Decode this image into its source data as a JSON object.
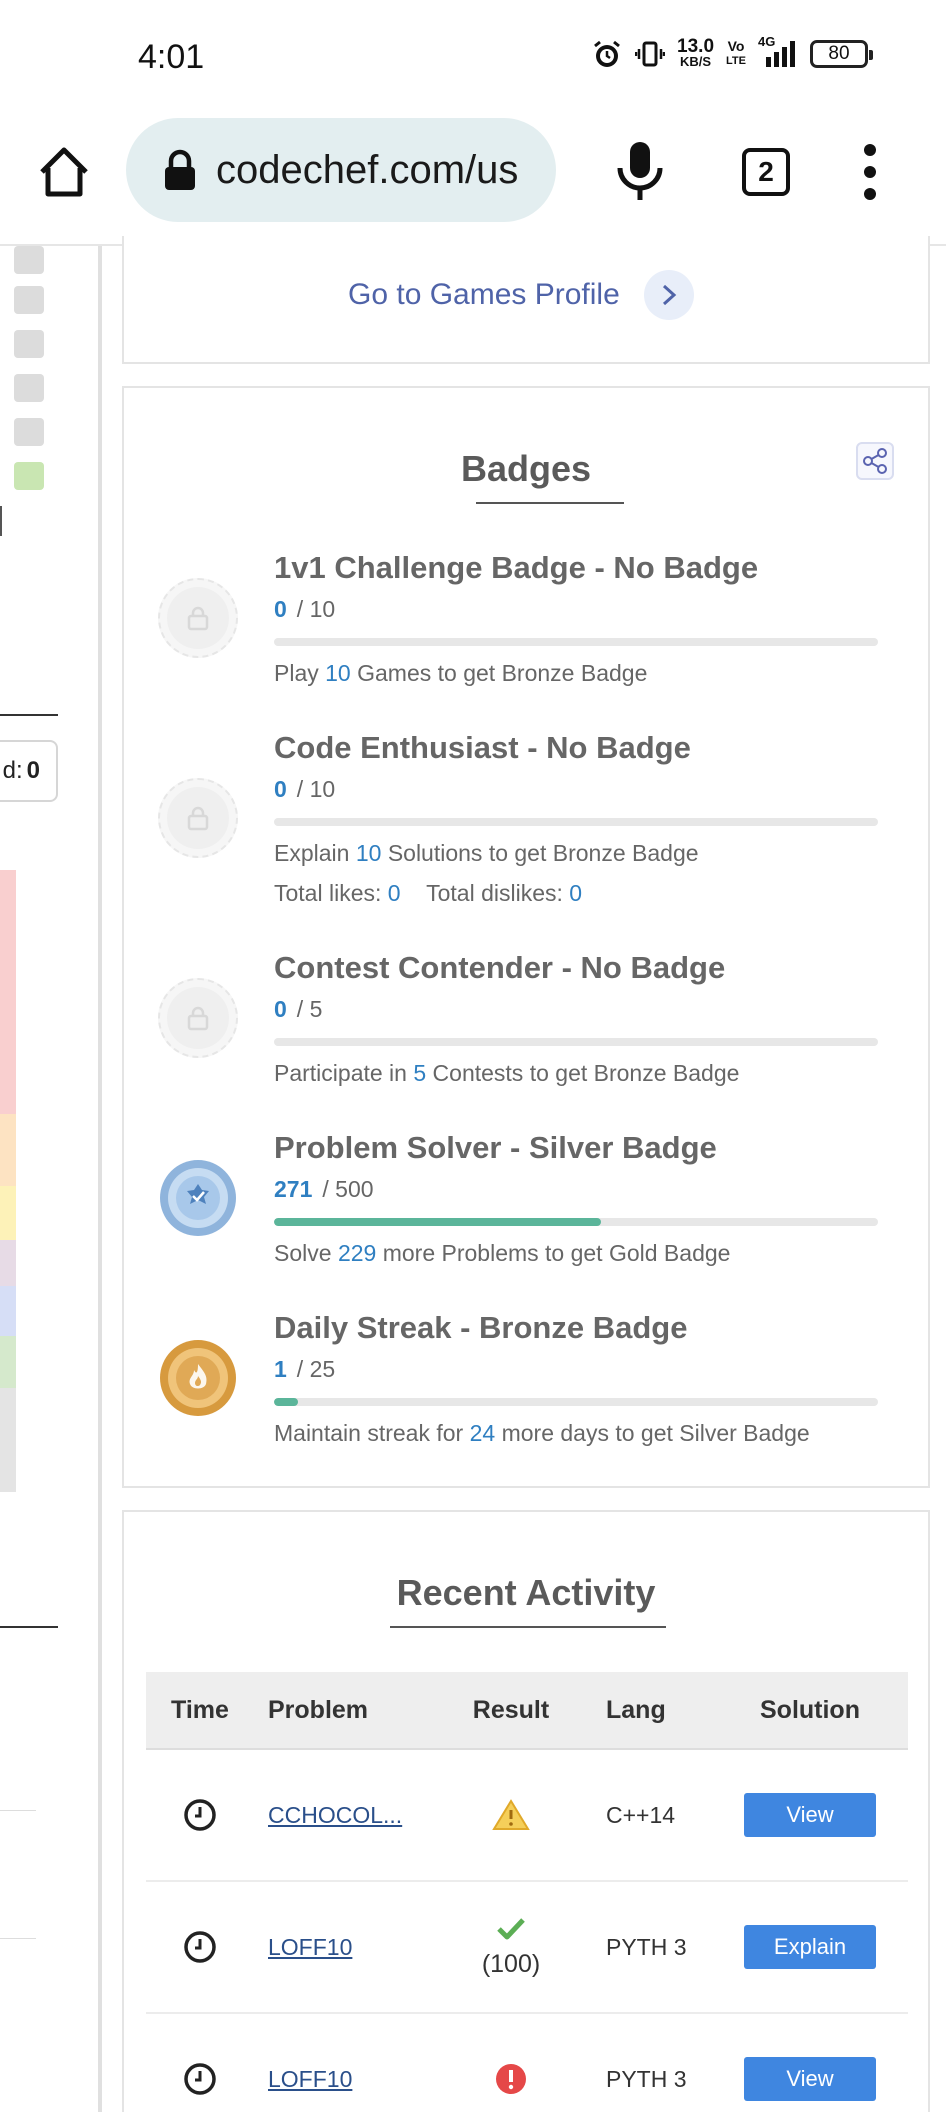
{
  "status_bar": {
    "time": "4:01",
    "net_speed_value": "13.0",
    "net_speed_unit": "KB/S",
    "volte_top": "Vo",
    "volte_bottom": "LTE",
    "network": "4G",
    "battery": "80",
    "icons": [
      "alarm-icon",
      "vibrate-icon",
      "signal-icon",
      "battery-icon"
    ]
  },
  "browser": {
    "url": "codechef.com/us",
    "tab_count": "2",
    "icons": [
      "home-icon",
      "lock-icon",
      "mic-icon",
      "tabs-icon",
      "more-vert-icon"
    ]
  },
  "left_panel": {
    "solved_label": "d:",
    "solved_value": "0"
  },
  "games": {
    "link_label": "Go to Games Profile"
  },
  "badges": {
    "title": "Badges",
    "items": [
      {
        "name": "1v1 Challenge Badge - No Badge",
        "current": "0",
        "total": "/ 10",
        "progress_fraction": 0,
        "desc_pre": "Play",
        "desc_num": "10",
        "desc_post": "Games to get Bronze Badge",
        "state": "locked"
      },
      {
        "name": "Code Enthusiast - No Badge",
        "current": "0",
        "total": "/ 10",
        "progress_fraction": 0,
        "desc_pre": "Explain",
        "desc_num": "10",
        "desc_post": "Solutions to get Bronze Badge",
        "likes_label": "Total likes:",
        "likes_value": "0",
        "dislikes_label": "Total dislikes:",
        "dislikes_value": "0",
        "state": "locked"
      },
      {
        "name": "Contest Contender - No Badge",
        "current": "0",
        "total": "/ 5",
        "progress_fraction": 0,
        "desc_pre": "Participate in",
        "desc_num": "5",
        "desc_post": "Contests to get Bronze Badge",
        "state": "locked"
      },
      {
        "name": "Problem Solver - Silver Badge",
        "current": "271",
        "total": "/ 500",
        "progress_fraction": 0.542,
        "desc_pre": "Solve",
        "desc_num": "229",
        "desc_post": "more Problems to get Gold Badge",
        "state": "silver"
      },
      {
        "name": "Daily Streak - Bronze Badge",
        "current": "1",
        "total": "/ 25",
        "progress_fraction": 0.04,
        "desc_pre": "Maintain streak for",
        "desc_num": "24",
        "desc_post": "more days to get Silver Badge",
        "state": "bronze"
      }
    ]
  },
  "activity": {
    "title": "Recent Activity",
    "columns": [
      "Time",
      "Problem",
      "Result",
      "Lang",
      "Solution"
    ],
    "rows": [
      {
        "problem": "CCHOCOL...",
        "result_icon": "warning-icon",
        "score": "",
        "lang": "C++14",
        "action": "View"
      },
      {
        "problem": "LOFF10",
        "result_icon": "check-icon",
        "score": "(100)",
        "lang": "PYTH 3",
        "action": "Explain"
      },
      {
        "problem": "LOFF10",
        "result_icon": "error-icon",
        "score": "",
        "lang": "PYTH 3",
        "action": "View"
      }
    ]
  },
  "colors": {
    "accent_blue": "#3f86e0",
    "progress_green": "#5bb59a",
    "number_blue": "#2f7fc1",
    "link_purple_blue": "#4f63a8"
  }
}
